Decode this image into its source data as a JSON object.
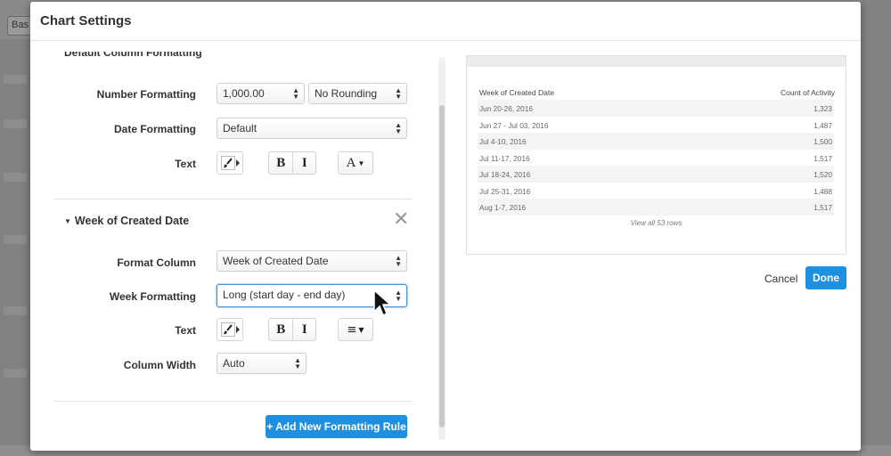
{
  "modal": {
    "title": "Chart Settings"
  },
  "default_formatting": {
    "heading": "Default Column Formatting",
    "number_formatting": {
      "label": "Number Formatting",
      "value": "1,000.00",
      "rounding": "No Rounding"
    },
    "date_formatting": {
      "label": "Date Formatting",
      "value": "Default"
    },
    "text": {
      "label": "Text",
      "bold": "B",
      "italic": "I",
      "color": "A"
    }
  },
  "column_section": {
    "title": "Week of Created Date",
    "format_column": {
      "label": "Format Column",
      "value": "Week of Created Date"
    },
    "week_formatting": {
      "label": "Week Formatting",
      "value": "Long (start day - end day)"
    },
    "text": {
      "label": "Text",
      "bold": "B",
      "italic": "I",
      "align": "≡"
    },
    "column_width": {
      "label": "Column Width",
      "value": "Auto"
    }
  },
  "add_rule_button": "+ Add New Formatting Rule",
  "preview": {
    "columns": [
      "Week of Created Date",
      "Count of Activity"
    ],
    "rows": [
      [
        "Jun 20-26, 2016",
        "1,323"
      ],
      [
        "Jun 27 - Jul 03, 2016",
        "1,487"
      ],
      [
        "Jul 4-10, 2016",
        "1,500"
      ],
      [
        "Jul 11-17, 2016",
        "1,517"
      ],
      [
        "Jul 18-24, 2016",
        "1,520"
      ],
      [
        "Jul 25-31, 2016",
        "1,488"
      ],
      [
        "Aug 1-7, 2016",
        "1,517"
      ]
    ],
    "view_all": "View all 53 rows"
  },
  "footer": {
    "cancel": "Cancel",
    "done": "Done"
  },
  "background": {
    "select": "Bas"
  },
  "colors": {
    "primary": "#1f8fe0",
    "active_border": "#4a90d9"
  }
}
